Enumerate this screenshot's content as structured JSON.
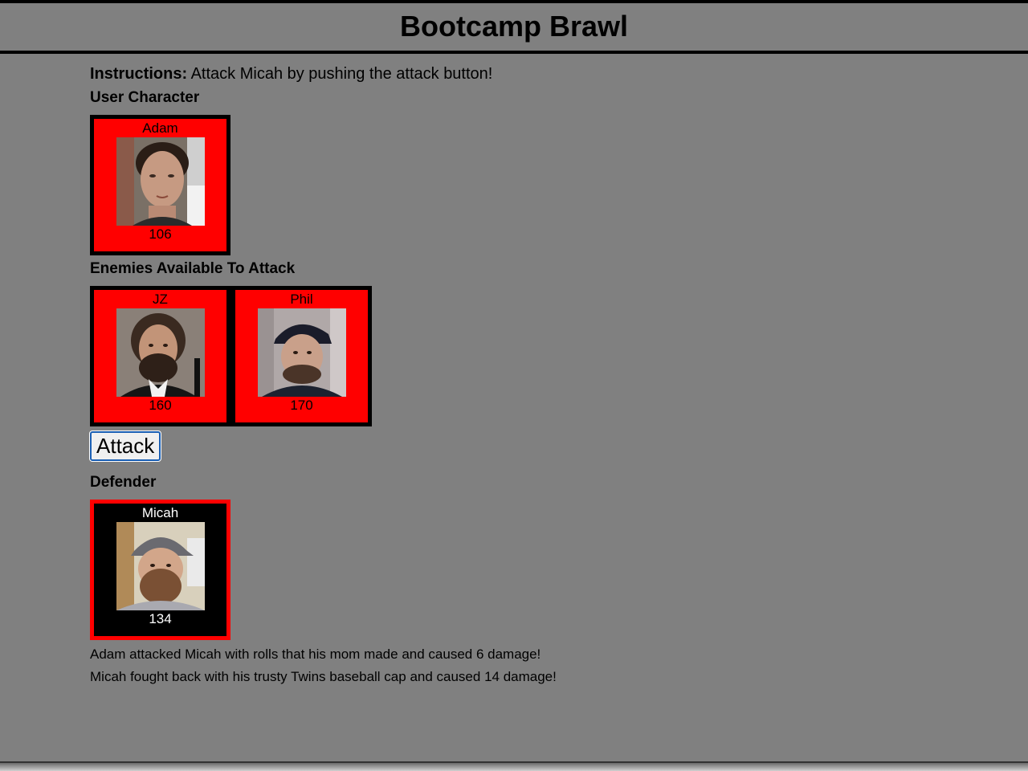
{
  "header": {
    "title": "Bootcamp Brawl"
  },
  "instructions": {
    "label": "Instructions:",
    "text": "Attack Micah by pushing the attack button!"
  },
  "user_section": {
    "title": "User Character",
    "character": {
      "name": "Adam",
      "hp": "106"
    }
  },
  "enemies_section": {
    "title": "Enemies Available To Attack",
    "enemies": [
      {
        "name": "JZ",
        "hp": "160"
      },
      {
        "name": "Phil",
        "hp": "170"
      }
    ]
  },
  "attack_button": {
    "label": "Attack"
  },
  "defender_section": {
    "title": "Defender",
    "character": {
      "name": "Micah",
      "hp": "134"
    }
  },
  "log": [
    "Adam attacked Micah with rolls that his mom made and caused 6 damage!",
    "Micah fought back with his trusty Twins baseball cap and caused 14 damage!"
  ],
  "colors": {
    "background": "#808080",
    "card_red": "#ff0000",
    "card_black": "#000000"
  }
}
